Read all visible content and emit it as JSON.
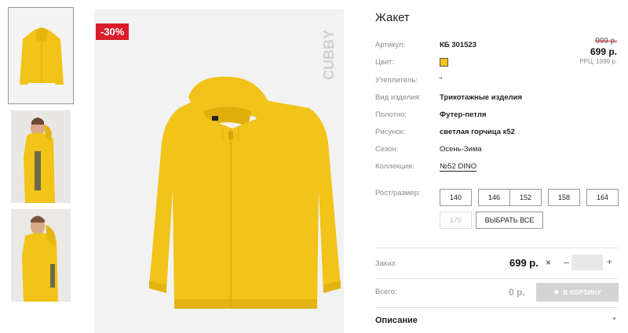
{
  "thumbnails": [
    {
      "alt": "jacket-front",
      "active": true
    },
    {
      "alt": "model-side",
      "active": false
    },
    {
      "alt": "model-back",
      "active": false
    }
  ],
  "badge": {
    "discount": "-30%"
  },
  "brand": {
    "text": "CUBBY"
  },
  "product": {
    "title": "Жакет",
    "attributes": [
      {
        "label": "Артикул:",
        "value": "КБ 301523"
      },
      {
        "label": "Цвет:",
        "value": ""
      },
      {
        "label": "Утеплитель:",
        "value": "\""
      },
      {
        "label": "Вид изделия:",
        "value": "Трикотажные изделия"
      },
      {
        "label": "Полотно:",
        "value": "Футер-петля"
      },
      {
        "label": "Рисунок:",
        "value": "светлая горчица к52"
      },
      {
        "label": "Сезон:",
        "value": "Осень-Зима"
      },
      {
        "label": "Коллекция:",
        "value": "№52 DINO"
      }
    ],
    "color_hex": "#f2c318"
  },
  "price": {
    "old": "999 р.",
    "current": "699 р.",
    "rrc": "РРЦ: 1999 р."
  },
  "sizes": {
    "label": "Рост/размер:",
    "options": [
      "140",
      "146",
      "152",
      "158",
      "164",
      "170"
    ],
    "disabled": [
      "170"
    ],
    "select_all": "ВЫБРАТЬ ВСЕ"
  },
  "order": {
    "label": "Заказ:",
    "price": "699 р.",
    "times": "×",
    "minus": "–",
    "plus": "+",
    "quantity": ""
  },
  "total": {
    "label": "Всего:",
    "value": "0 р.",
    "cart_button": "В КОРЗИНУ"
  },
  "description": {
    "label": "Описание"
  },
  "colors": {
    "accent": "#d81e2b",
    "jacket": "#f2c318"
  }
}
